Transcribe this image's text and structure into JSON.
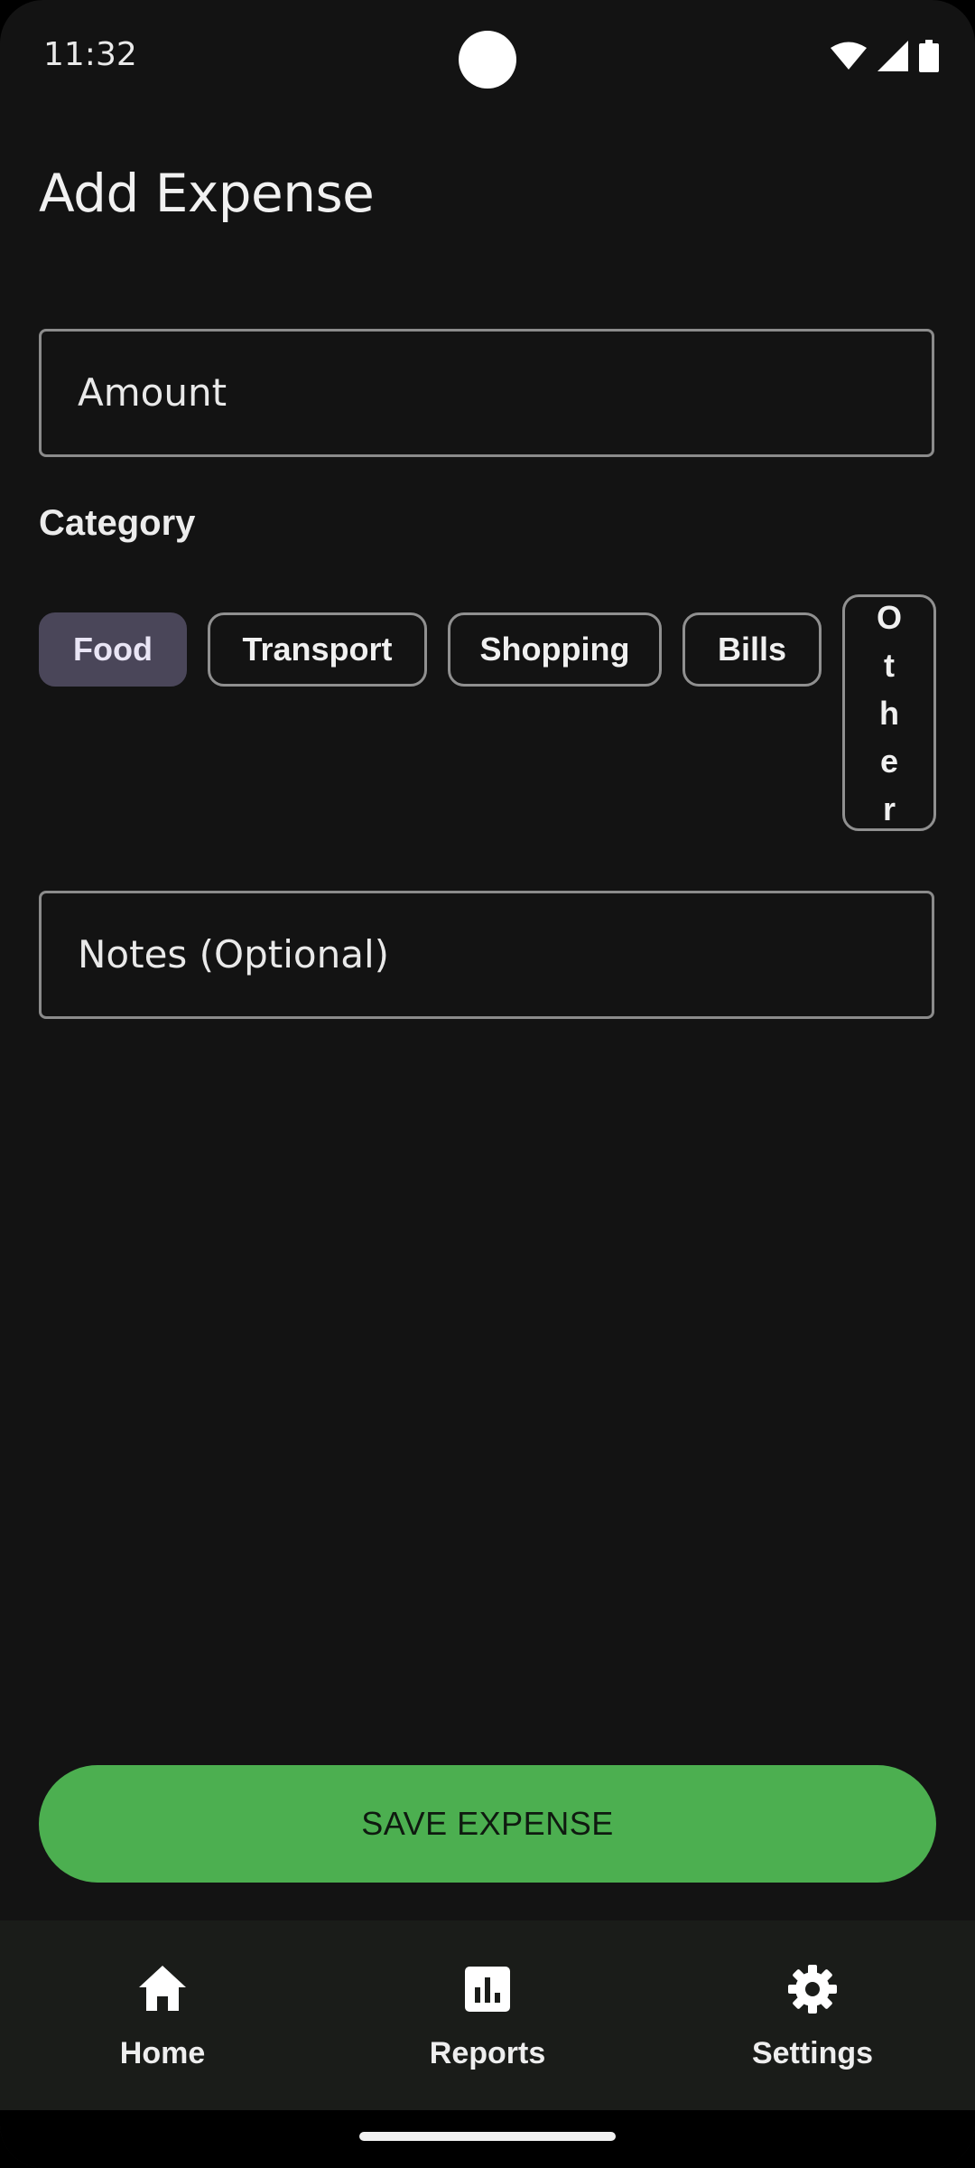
{
  "status_bar": {
    "time": "11:32",
    "icons": [
      "wifi-icon",
      "signal-icon",
      "battery-icon"
    ]
  },
  "page": {
    "title": "Add Expense"
  },
  "form": {
    "amount_placeholder": "Amount",
    "category_label": "Category",
    "categories": [
      {
        "label": "Food",
        "selected": true
      },
      {
        "label": "Transport",
        "selected": false
      },
      {
        "label": "Shopping",
        "selected": false
      },
      {
        "label": "Bills",
        "selected": false
      },
      {
        "label": "Other",
        "selected": false
      }
    ],
    "notes_placeholder": "Notes (Optional)"
  },
  "actions": {
    "save_label": "SAVE EXPENSE"
  },
  "bottom_nav": {
    "items": [
      {
        "label": "Home",
        "icon": "home-icon"
      },
      {
        "label": "Reports",
        "icon": "bar-chart-icon"
      },
      {
        "label": "Settings",
        "icon": "gear-icon"
      }
    ]
  },
  "colors": {
    "background": "#131313",
    "accent": "#4caf50",
    "chip_selected": "#4a4659",
    "nav_background": "#1a1c19"
  }
}
